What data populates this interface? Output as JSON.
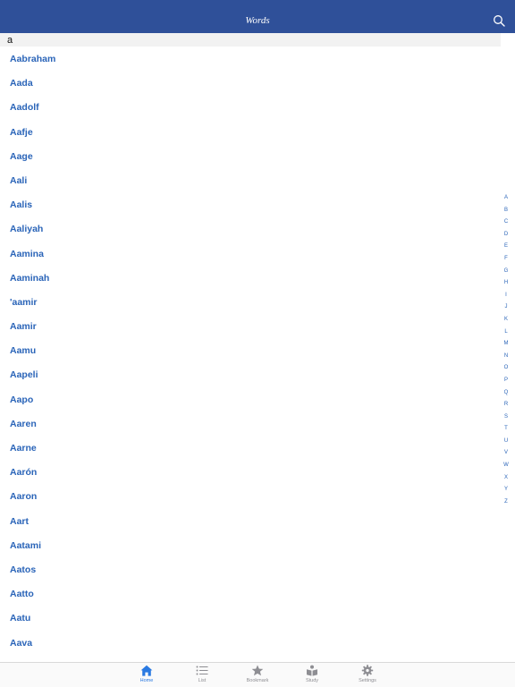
{
  "header": {
    "title": "Words"
  },
  "search": {
    "value": "a",
    "icon": "search-icon"
  },
  "words": [
    "Aabraham",
    "Aada",
    "Aadolf",
    "Aafje",
    "Aage",
    "Aali",
    "Aalis",
    "Aaliyah",
    "Aamina",
    "Aaminah",
    "'aamir",
    "Aamir",
    "Aamu",
    "Aapeli",
    "Aapo",
    "Aaren",
    "Aarne",
    "Aarón",
    "Aaron",
    "Aart",
    "Aatami",
    "Aatos",
    "Aatto",
    "Aatu",
    "Aava"
  ],
  "index_letters": [
    "A",
    "B",
    "C",
    "D",
    "E",
    "F",
    "G",
    "H",
    "I",
    "J",
    "K",
    "L",
    "M",
    "N",
    "O",
    "P",
    "Q",
    "R",
    "S",
    "T",
    "U",
    "V",
    "W",
    "X",
    "Y",
    "Z"
  ],
  "tabs": [
    {
      "label": "Home",
      "icon": "home-icon",
      "active": true
    },
    {
      "label": "List",
      "icon": "list-icon",
      "active": false
    },
    {
      "label": "Bookmark",
      "icon": "star-icon",
      "active": false
    },
    {
      "label": "Study",
      "icon": "book-icon",
      "active": false
    },
    {
      "label": "Settings",
      "icon": "gear-icon",
      "active": false
    }
  ],
  "colors": {
    "navbar": "#2f5099",
    "link": "#2a64b8",
    "tab_active": "#2a7ae2",
    "tab_inactive": "#8e8e93"
  }
}
